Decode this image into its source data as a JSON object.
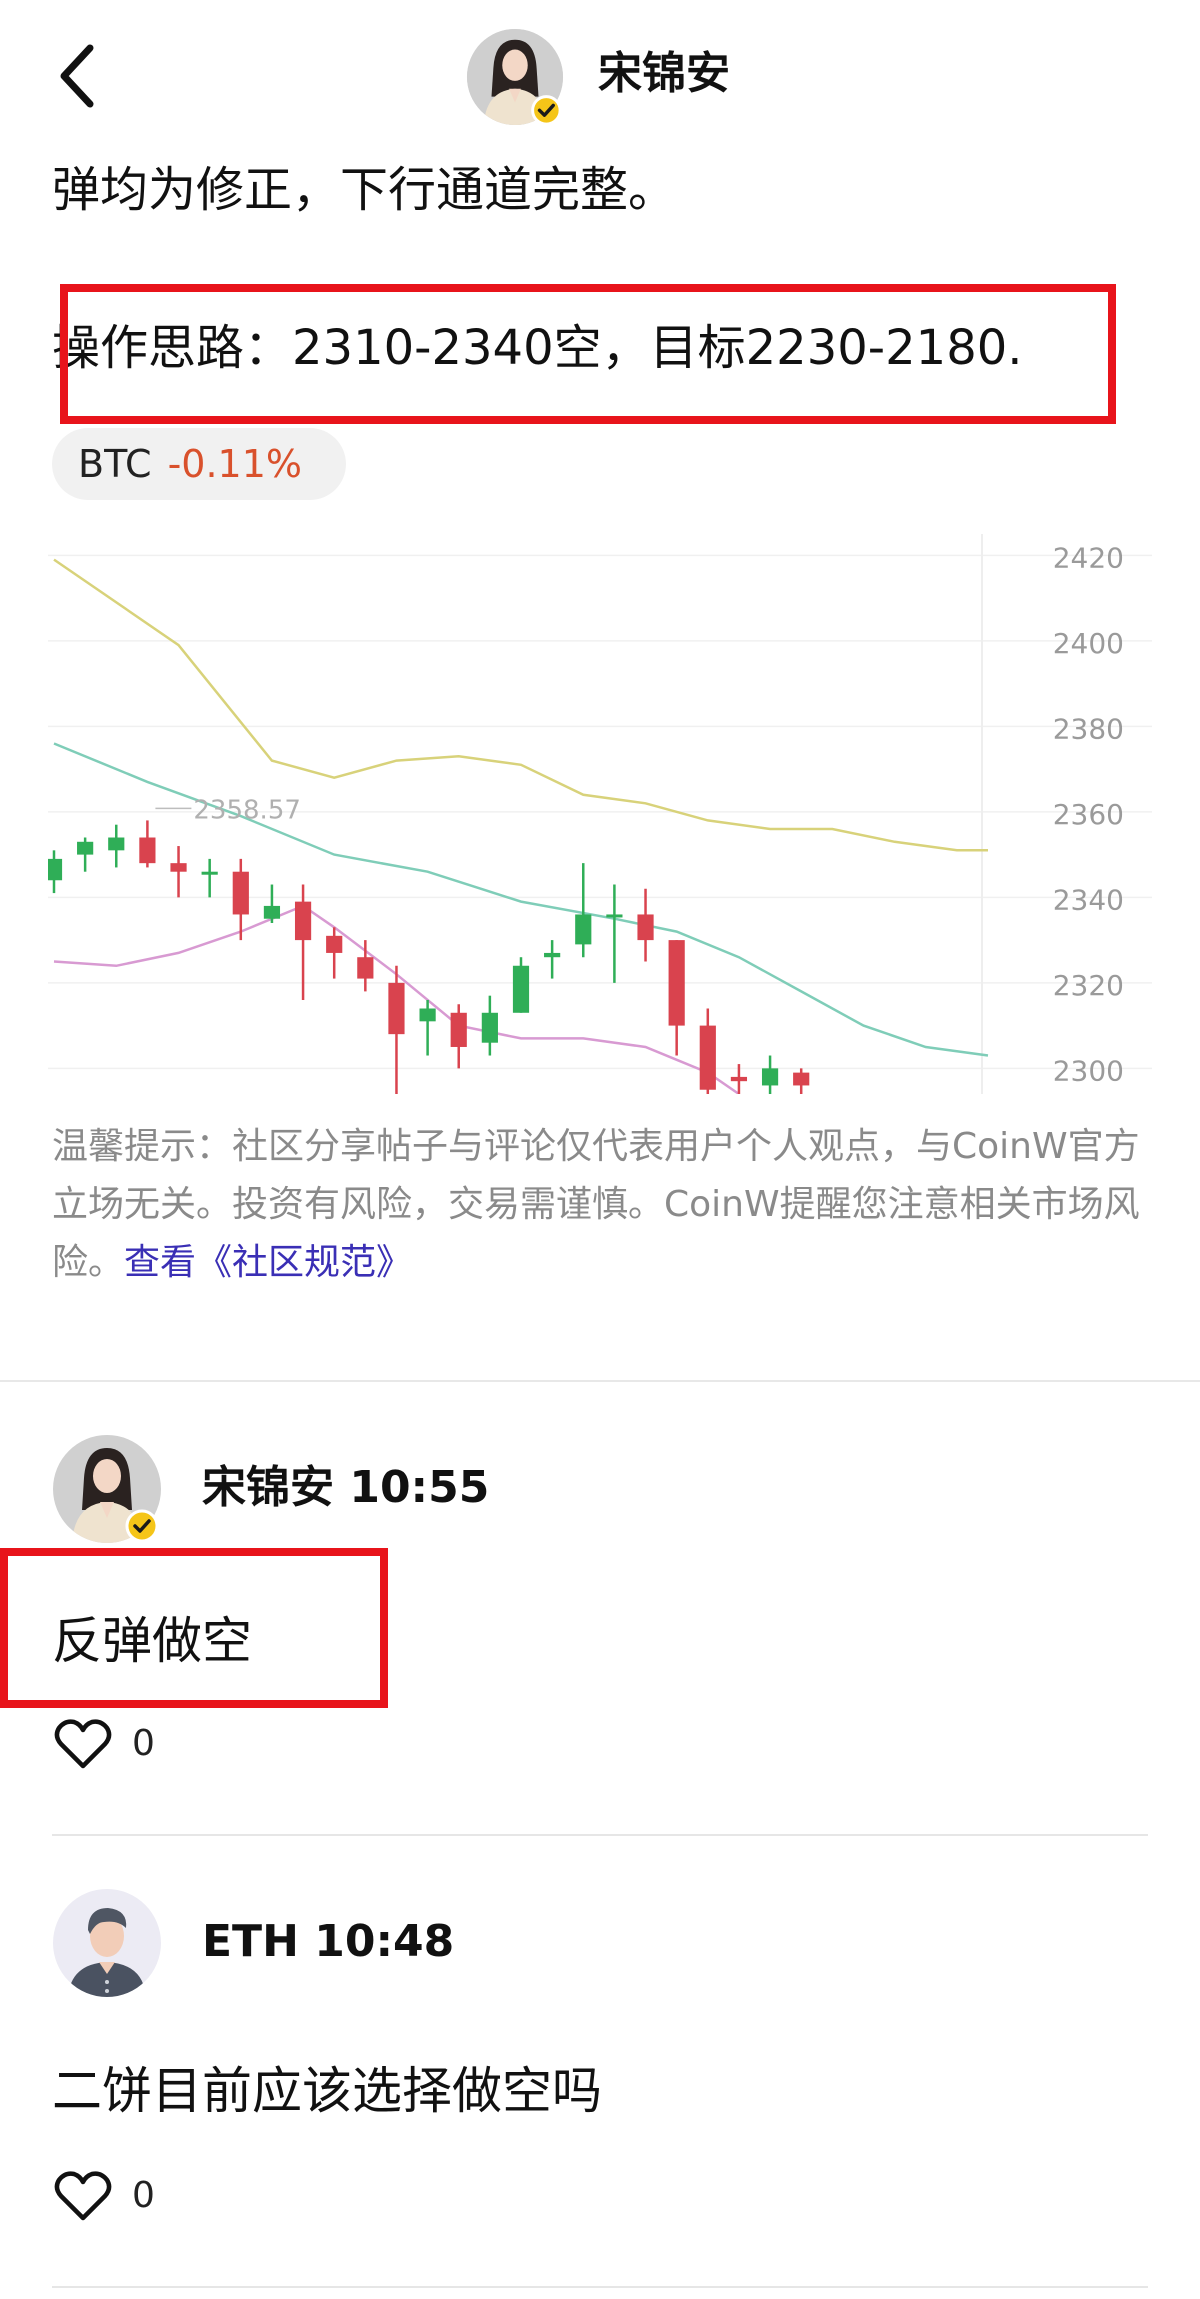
{
  "header": {
    "author_name": "宋锦安"
  },
  "post": {
    "line1": "弹均为修正，下行通道完整。",
    "line2": "操作思路：2310-2340空，目标2230-2180."
  },
  "tag": {
    "symbol": "BTC",
    "change": "-0.11%"
  },
  "chart_data": {
    "type": "candlestick",
    "y_ticks": [
      "2420",
      "2400",
      "2380",
      "2360",
      "2340",
      "2320",
      "2300"
    ],
    "ylim": [
      2294,
      2425
    ],
    "annotation": "2358.57",
    "candles": [
      {
        "o": 2344,
        "c": 2349,
        "h": 2351,
        "l": 2341
      },
      {
        "o": 2350,
        "c": 2353,
        "h": 2354,
        "l": 2346
      },
      {
        "o": 2351,
        "c": 2354,
        "h": 2357,
        "l": 2347
      },
      {
        "o": 2354,
        "c": 2348,
        "h": 2358,
        "l": 2347
      },
      {
        "o": 2348,
        "c": 2346,
        "h": 2352,
        "l": 2340
      },
      {
        "o": 2346,
        "c": 2346,
        "h": 2349,
        "l": 2340
      },
      {
        "o": 2346,
        "c": 2336,
        "h": 2349,
        "l": 2330
      },
      {
        "o": 2335,
        "c": 2338,
        "h": 2343,
        "l": 2334
      },
      {
        "o": 2339,
        "c": 2330,
        "h": 2343,
        "l": 2316
      },
      {
        "o": 2331,
        "c": 2327,
        "h": 2333,
        "l": 2321
      },
      {
        "o": 2326,
        "c": 2321,
        "h": 2330,
        "l": 2318
      },
      {
        "o": 2320,
        "c": 2308,
        "h": 2324,
        "l": 2288
      },
      {
        "o": 2311,
        "c": 2314,
        "h": 2316,
        "l": 2303
      },
      {
        "o": 2313,
        "c": 2305,
        "h": 2315,
        "l": 2300
      },
      {
        "o": 2306,
        "c": 2313,
        "h": 2317,
        "l": 2303
      },
      {
        "o": 2313,
        "c": 2324,
        "h": 2326,
        "l": 2313
      },
      {
        "o": 2326,
        "c": 2327,
        "h": 2330,
        "l": 2321
      },
      {
        "o": 2329,
        "c": 2336,
        "h": 2348,
        "l": 2326
      },
      {
        "o": 2336,
        "c": 2336,
        "h": 2343,
        "l": 2320
      },
      {
        "o": 2336,
        "c": 2330,
        "h": 2342,
        "l": 2325
      },
      {
        "o": 2330,
        "c": 2310,
        "h": 2330,
        "l": 2303
      },
      {
        "o": 2310,
        "c": 2295,
        "h": 2314,
        "l": 2288
      },
      {
        "o": 2298,
        "c": 2297,
        "h": 2301,
        "l": 2294
      },
      {
        "o": 2296,
        "c": 2300,
        "h": 2303,
        "l": 2293
      },
      {
        "o": 2299,
        "c": 2296,
        "h": 2300,
        "l": 2294
      }
    ],
    "series": [
      {
        "color": "#d8d27a",
        "points": [
          [
            0,
            2419
          ],
          [
            4,
            2399
          ],
          [
            7,
            2372
          ],
          [
            9,
            2368
          ],
          [
            11,
            2372
          ],
          [
            13,
            2373
          ],
          [
            15,
            2371
          ],
          [
            17,
            2364
          ],
          [
            19,
            2362
          ],
          [
            21,
            2358
          ],
          [
            23,
            2356
          ],
          [
            25,
            2356
          ],
          [
            27,
            2353
          ],
          [
            29,
            2351
          ],
          [
            30,
            2351
          ]
        ]
      },
      {
        "color": "#7fcdb8",
        "points": [
          [
            0,
            2376
          ],
          [
            3,
            2367
          ],
          [
            6,
            2359
          ],
          [
            9,
            2350
          ],
          [
            12,
            2346
          ],
          [
            15,
            2339
          ],
          [
            18,
            2335
          ],
          [
            20,
            2332
          ],
          [
            22,
            2326
          ],
          [
            24,
            2318
          ],
          [
            26,
            2310
          ],
          [
            28,
            2305
          ],
          [
            30,
            2303
          ]
        ]
      },
      {
        "color": "#d89ad2",
        "points": [
          [
            0,
            2325
          ],
          [
            2,
            2324
          ],
          [
            4,
            2327
          ],
          [
            6,
            2332
          ],
          [
            8,
            2338
          ],
          [
            9,
            2333
          ],
          [
            11,
            2322
          ],
          [
            13,
            2310
          ],
          [
            15,
            2307
          ],
          [
            17,
            2307
          ],
          [
            19,
            2305
          ],
          [
            20,
            2302
          ],
          [
            21,
            2299
          ],
          [
            22,
            2294
          ]
        ]
      }
    ],
    "colors": {
      "up": "#2fae57",
      "down": "#d9434e"
    }
  },
  "disclaimer": {
    "text": "温馨提示：社区分享帖子与评论仅代表用户个人观点，与CoinW官方立场无关。投资有风险，交易需谨慎。CoinW提醒您注意相关市场风险。",
    "link": "查看《社区规范》"
  },
  "comments": [
    {
      "author": "宋锦安",
      "time": "10:55",
      "text": "反弹做空",
      "likes": "0"
    },
    {
      "author": "ETH",
      "time": "10:48",
      "text": "二饼目前应该选择做空吗",
      "likes": "0"
    }
  ],
  "icons": {
    "back": "chevron-left-icon",
    "like": "heart-outline-icon",
    "verified": "verified-badge-icon"
  }
}
